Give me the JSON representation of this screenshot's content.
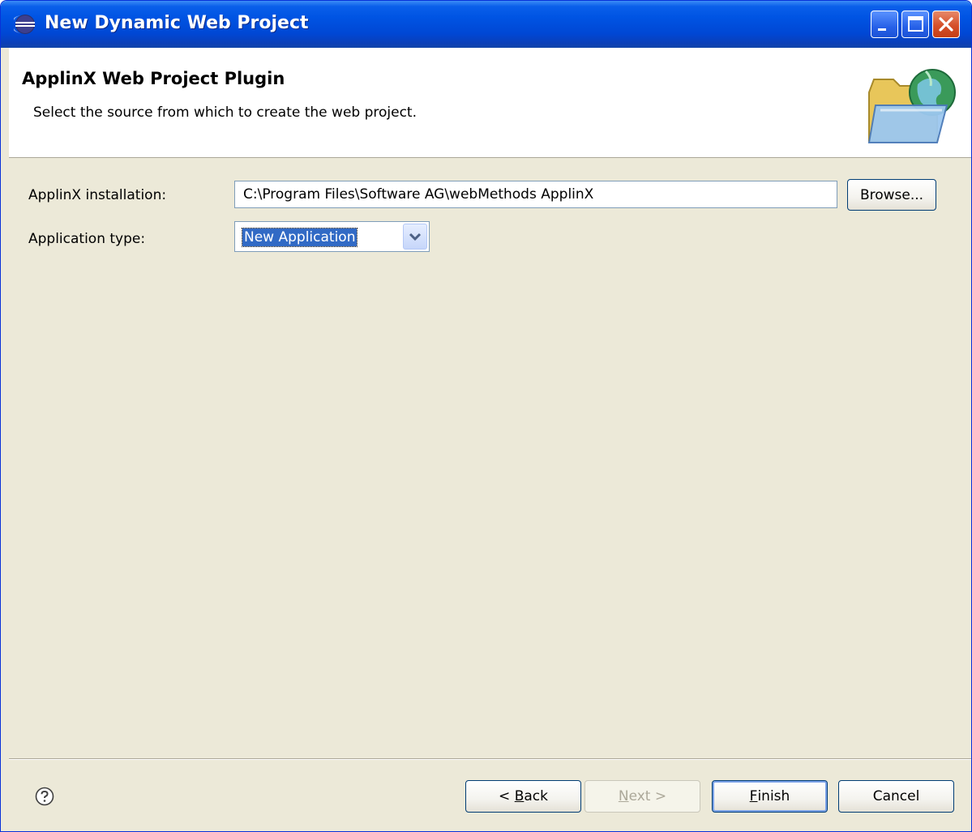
{
  "window": {
    "title": "New Dynamic Web Project",
    "controls": [
      "minimize-icon",
      "maximize-icon",
      "close-icon"
    ]
  },
  "header": {
    "title": "ApplinX Web Project Plugin",
    "description": "Select the source from which to create the web project.",
    "banner_icon": "folder-globe-icon"
  },
  "form": {
    "installation_label": "ApplinX installation:",
    "installation_value": "C:\\Program Files\\Software AG\\webMethods ApplinX",
    "browse_label": "Browse...",
    "app_type_label": "Application type:",
    "app_type_value": "New Application"
  },
  "footer": {
    "help_icon": "help-icon",
    "back_pre": "< ",
    "back_key": "B",
    "back_post": "ack",
    "next_key": "N",
    "next_post": "ext >",
    "finish_key": "F",
    "finish_post": "inish",
    "cancel_label": "Cancel"
  },
  "colors": {
    "title_bar": "#0054e3",
    "dialog_bg": "#ece9d8",
    "selection": "#316ac5",
    "close_button": "#d5502a"
  }
}
